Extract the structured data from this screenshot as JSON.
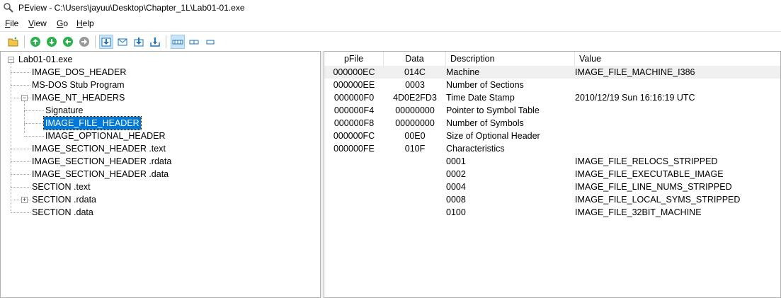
{
  "window": {
    "title": "PEview - C:\\Users\\jayuu\\Desktop\\Chapter_1L\\Lab01-01.exe"
  },
  "menu": [
    "File",
    "View",
    "Go",
    "Help"
  ],
  "toolbar": {
    "buttons": [
      "open-icon",
      "go-first-icon",
      "go-next-icon",
      "go-back-icon",
      "go-forward-icon",
      "view-hex-icon",
      "view-header-icon",
      "view-down-icon",
      "view-down2-icon",
      "mode-full-icon",
      "mode-medium-icon",
      "mode-small-icon"
    ]
  },
  "tree": {
    "root": "Lab01-01.exe",
    "items": [
      "IMAGE_DOS_HEADER",
      "MS-DOS Stub Program",
      "IMAGE_NT_HEADERS",
      "Signature",
      "IMAGE_FILE_HEADER",
      "IMAGE_OPTIONAL_HEADER",
      "IMAGE_SECTION_HEADER .text",
      "IMAGE_SECTION_HEADER .rdata",
      "IMAGE_SECTION_HEADER .data",
      "SECTION .text",
      "SECTION .rdata",
      "SECTION .data"
    ],
    "selected": "IMAGE_FILE_HEADER"
  },
  "table": {
    "columns": [
      "pFile",
      "Data",
      "Description",
      "Value"
    ],
    "rows": [
      {
        "pfile": "000000EC",
        "data": "014C",
        "desc": "Machine",
        "value": "IMAGE_FILE_MACHINE_I386"
      },
      {
        "pfile": "000000EE",
        "data": "0003",
        "desc": "Number of Sections",
        "value": ""
      },
      {
        "pfile": "000000F0",
        "data": "4D0E2FD3",
        "desc": "Time Date Stamp",
        "value": "2010/12/19 Sun 16:16:19 UTC"
      },
      {
        "pfile": "000000F4",
        "data": "00000000",
        "desc": "Pointer to Symbol Table",
        "value": ""
      },
      {
        "pfile": "000000F8",
        "data": "00000000",
        "desc": "Number of Symbols",
        "value": ""
      },
      {
        "pfile": "000000FC",
        "data": "00E0",
        "desc": "Size of Optional Header",
        "value": ""
      },
      {
        "pfile": "000000FE",
        "data": "010F",
        "desc": "Characteristics",
        "value": ""
      },
      {
        "pfile": "",
        "data": "",
        "desc": "0001",
        "value": "IMAGE_FILE_RELOCS_STRIPPED"
      },
      {
        "pfile": "",
        "data": "",
        "desc": "0002",
        "value": "IMAGE_FILE_EXECUTABLE_IMAGE"
      },
      {
        "pfile": "",
        "data": "",
        "desc": "0004",
        "value": "IMAGE_FILE_LINE_NUMS_STRIPPED"
      },
      {
        "pfile": "",
        "data": "",
        "desc": "0008",
        "value": "IMAGE_FILE_LOCAL_SYMS_STRIPPED"
      },
      {
        "pfile": "",
        "data": "",
        "desc": "0100",
        "value": "IMAGE_FILE_32BIT_MACHINE"
      }
    ]
  },
  "colors": {
    "selection": "#0078d7",
    "row_highlight": "#f0f0f0",
    "toolbar_green": "#2bb24c",
    "toolbar_blue": "#1e73be"
  }
}
